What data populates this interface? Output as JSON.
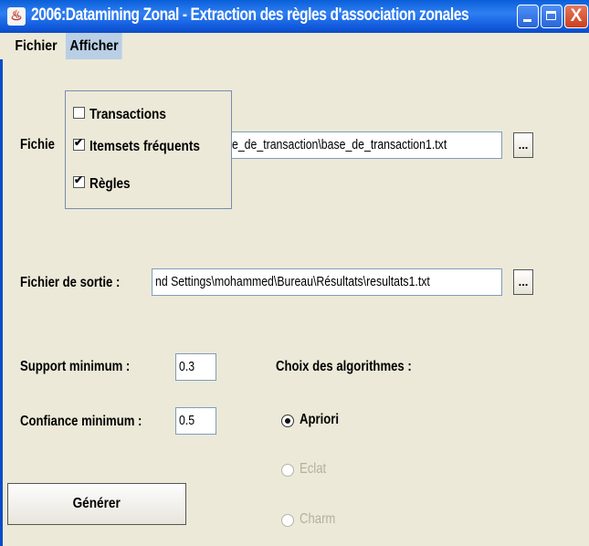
{
  "window": {
    "title": "2006:Datamining Zonal - Extraction des règles d'association zonales",
    "close_glyph": "X"
  },
  "menubar": {
    "fichier": "Fichier",
    "afficher": "Afficher"
  },
  "afficher_menu": {
    "items": [
      {
        "label": "Transactions",
        "checked": false
      },
      {
        "label": "Itemsets fréquents",
        "checked": true
      },
      {
        "label": "Règles",
        "checked": true
      }
    ]
  },
  "form": {
    "input_file_label": "Fichie",
    "input_file_value": "e_de_transaction\\base_de_transaction1.txt",
    "output_file_label": "Fichier de sortie :",
    "output_file_value": "nd Settings\\mohammed\\Bureau\\Résultats\\resultats1.txt",
    "browse_label": "...",
    "support_label": "Support minimum :",
    "support_value": "0.3",
    "confidence_label": "Confiance minimum :",
    "confidence_value": "0.5",
    "algorithms_label": "Choix des algorithmes :",
    "algorithms": [
      {
        "label": "Apriori",
        "selected": true,
        "enabled": true
      },
      {
        "label": "Eclat",
        "selected": false,
        "enabled": false
      },
      {
        "label": "Charm",
        "selected": false,
        "enabled": false
      }
    ],
    "generate_label": "Générer"
  },
  "colors": {
    "titlebar": "#1560e0",
    "menu_highlight": "#b8cfe5",
    "panel": "#ece9d8",
    "disabled_text": "#b4b0a0"
  }
}
